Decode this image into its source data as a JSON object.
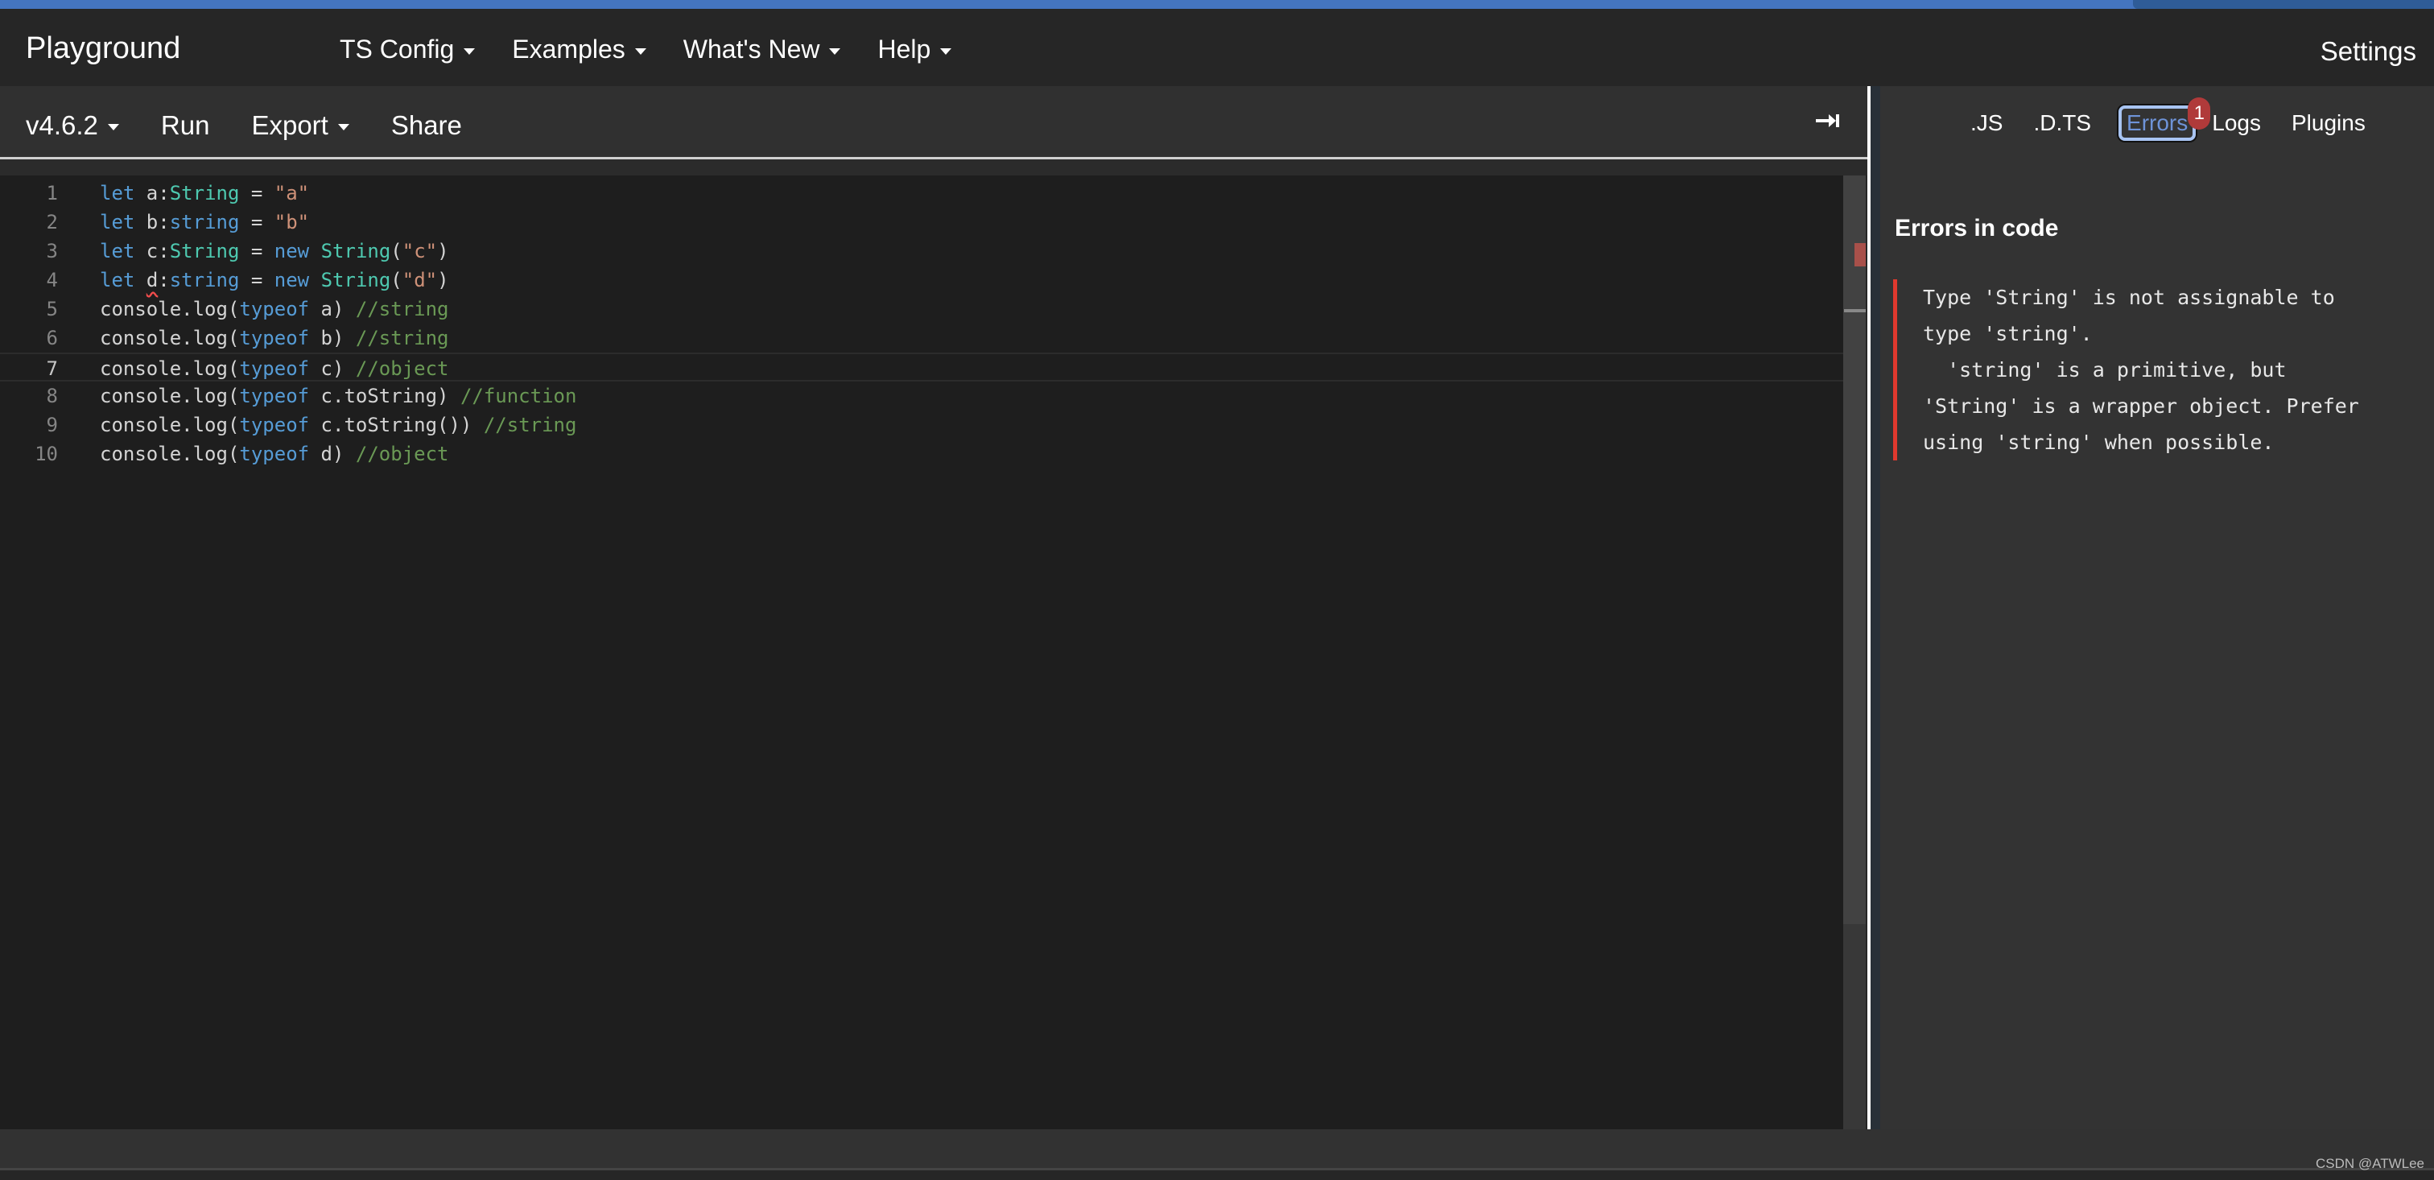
{
  "navbar": {
    "brand": "Playground",
    "menu": [
      {
        "label": "TS Config",
        "dropdown": true
      },
      {
        "label": "Examples",
        "dropdown": true
      },
      {
        "label": "What's New",
        "dropdown": true
      },
      {
        "label": "Help",
        "dropdown": true
      }
    ],
    "settings": "Settings"
  },
  "toolbar": {
    "version": "v4.6.2",
    "run": "Run",
    "export": "Export",
    "share": "Share",
    "collapse_icon": "arrow-to-right-icon"
  },
  "editor": {
    "current_line": 7,
    "lines": [
      {
        "n": "1",
        "tokens": [
          [
            "kw",
            "let"
          ],
          [
            "plain",
            " a:"
          ],
          [
            "type",
            "String"
          ],
          [
            "plain",
            " = "
          ],
          [
            "str",
            "\"a\""
          ]
        ]
      },
      {
        "n": "2",
        "tokens": [
          [
            "kw",
            "let"
          ],
          [
            "plain",
            " b:"
          ],
          [
            "kw",
            "string"
          ],
          [
            "plain",
            " = "
          ],
          [
            "str",
            "\"b\""
          ]
        ]
      },
      {
        "n": "3",
        "tokens": [
          [
            "kw",
            "let"
          ],
          [
            "plain",
            " c:"
          ],
          [
            "type",
            "String"
          ],
          [
            "plain",
            " = "
          ],
          [
            "kw",
            "new"
          ],
          [
            "plain",
            " "
          ],
          [
            "type",
            "String"
          ],
          [
            "plain",
            "("
          ],
          [
            "str",
            "\"c\""
          ],
          [
            "plain",
            ")"
          ]
        ]
      },
      {
        "n": "4",
        "tokens": [
          [
            "kw",
            "let"
          ],
          [
            "plain",
            " "
          ],
          [
            "err",
            "d"
          ],
          [
            "plain",
            ":"
          ],
          [
            "kw",
            "string"
          ],
          [
            "plain",
            " = "
          ],
          [
            "kw",
            "new"
          ],
          [
            "plain",
            " "
          ],
          [
            "type",
            "String"
          ],
          [
            "plain",
            "("
          ],
          [
            "str",
            "\"d\""
          ],
          [
            "plain",
            ")"
          ]
        ]
      },
      {
        "n": "5",
        "tokens": [
          [
            "plain",
            "console.log("
          ],
          [
            "kw",
            "typeof"
          ],
          [
            "plain",
            " a) "
          ],
          [
            "com",
            "//string"
          ]
        ]
      },
      {
        "n": "6",
        "tokens": [
          [
            "plain",
            "console.log("
          ],
          [
            "kw",
            "typeof"
          ],
          [
            "plain",
            " b) "
          ],
          [
            "com",
            "//string"
          ]
        ]
      },
      {
        "n": "7",
        "tokens": [
          [
            "plain",
            "console.log("
          ],
          [
            "kw",
            "typeof"
          ],
          [
            "plain",
            " c) "
          ],
          [
            "com",
            "//object"
          ]
        ]
      },
      {
        "n": "8",
        "tokens": [
          [
            "plain",
            "console.log("
          ],
          [
            "kw",
            "typeof"
          ],
          [
            "plain",
            " c.toString) "
          ],
          [
            "com",
            "//function"
          ]
        ]
      },
      {
        "n": "9",
        "tokens": [
          [
            "plain",
            "console.log("
          ],
          [
            "kw",
            "typeof"
          ],
          [
            "plain",
            " c.toString()) "
          ],
          [
            "com",
            "//string"
          ]
        ]
      },
      {
        "n": "10",
        "tokens": [
          [
            "plain",
            "console.log("
          ],
          [
            "kw",
            "typeof"
          ],
          [
            "plain",
            " d) "
          ],
          [
            "com",
            "//object"
          ]
        ]
      }
    ]
  },
  "sidebar": {
    "tabs": [
      {
        "label": ".JS",
        "active": false
      },
      {
        "label": ".D.TS",
        "active": false
      },
      {
        "label": "Errors",
        "active": true,
        "badge": "1"
      },
      {
        "label": "Logs",
        "active": false
      },
      {
        "label": "Plugins",
        "active": false
      }
    ],
    "errors_title": "Errors in code",
    "error_lines": [
      "Type 'String' is not assignable to",
      "type 'string'.",
      "  'string' is a primitive, but",
      "'String' is a wrapper object. Prefer",
      "using 'string' when possible."
    ]
  },
  "footer": {
    "watermark": "CSDN @ATWLee"
  },
  "colors": {
    "accent": "#4475c0",
    "error": "#e0392e",
    "badge": "#b03a3a",
    "active_tab": "#6e93d8"
  }
}
